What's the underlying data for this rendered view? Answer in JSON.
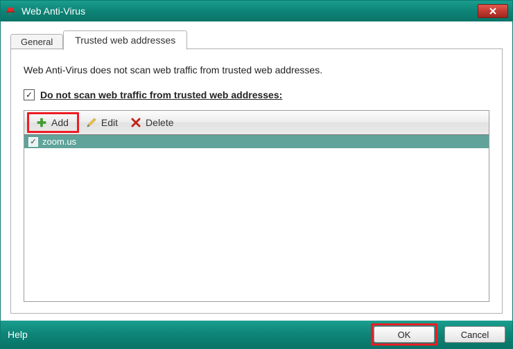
{
  "window": {
    "title": "Web Anti-Virus",
    "close_glyph": "✕"
  },
  "tabs": {
    "general": "General",
    "trusted": "Trusted web addresses"
  },
  "panel": {
    "description": "Web Anti-Virus does not scan web traffic from trusted web addresses.",
    "checkbox_label": "Do not scan web traffic from trusted web addresses:",
    "checkbox_checked": "✓"
  },
  "toolbar": {
    "add": "Add",
    "edit": "Edit",
    "delete": "Delete"
  },
  "list": {
    "items": [
      {
        "label": "zoom.us",
        "checked": "✓"
      }
    ]
  },
  "footer": {
    "help": "Help",
    "ok": "OK",
    "cancel": "Cancel"
  }
}
